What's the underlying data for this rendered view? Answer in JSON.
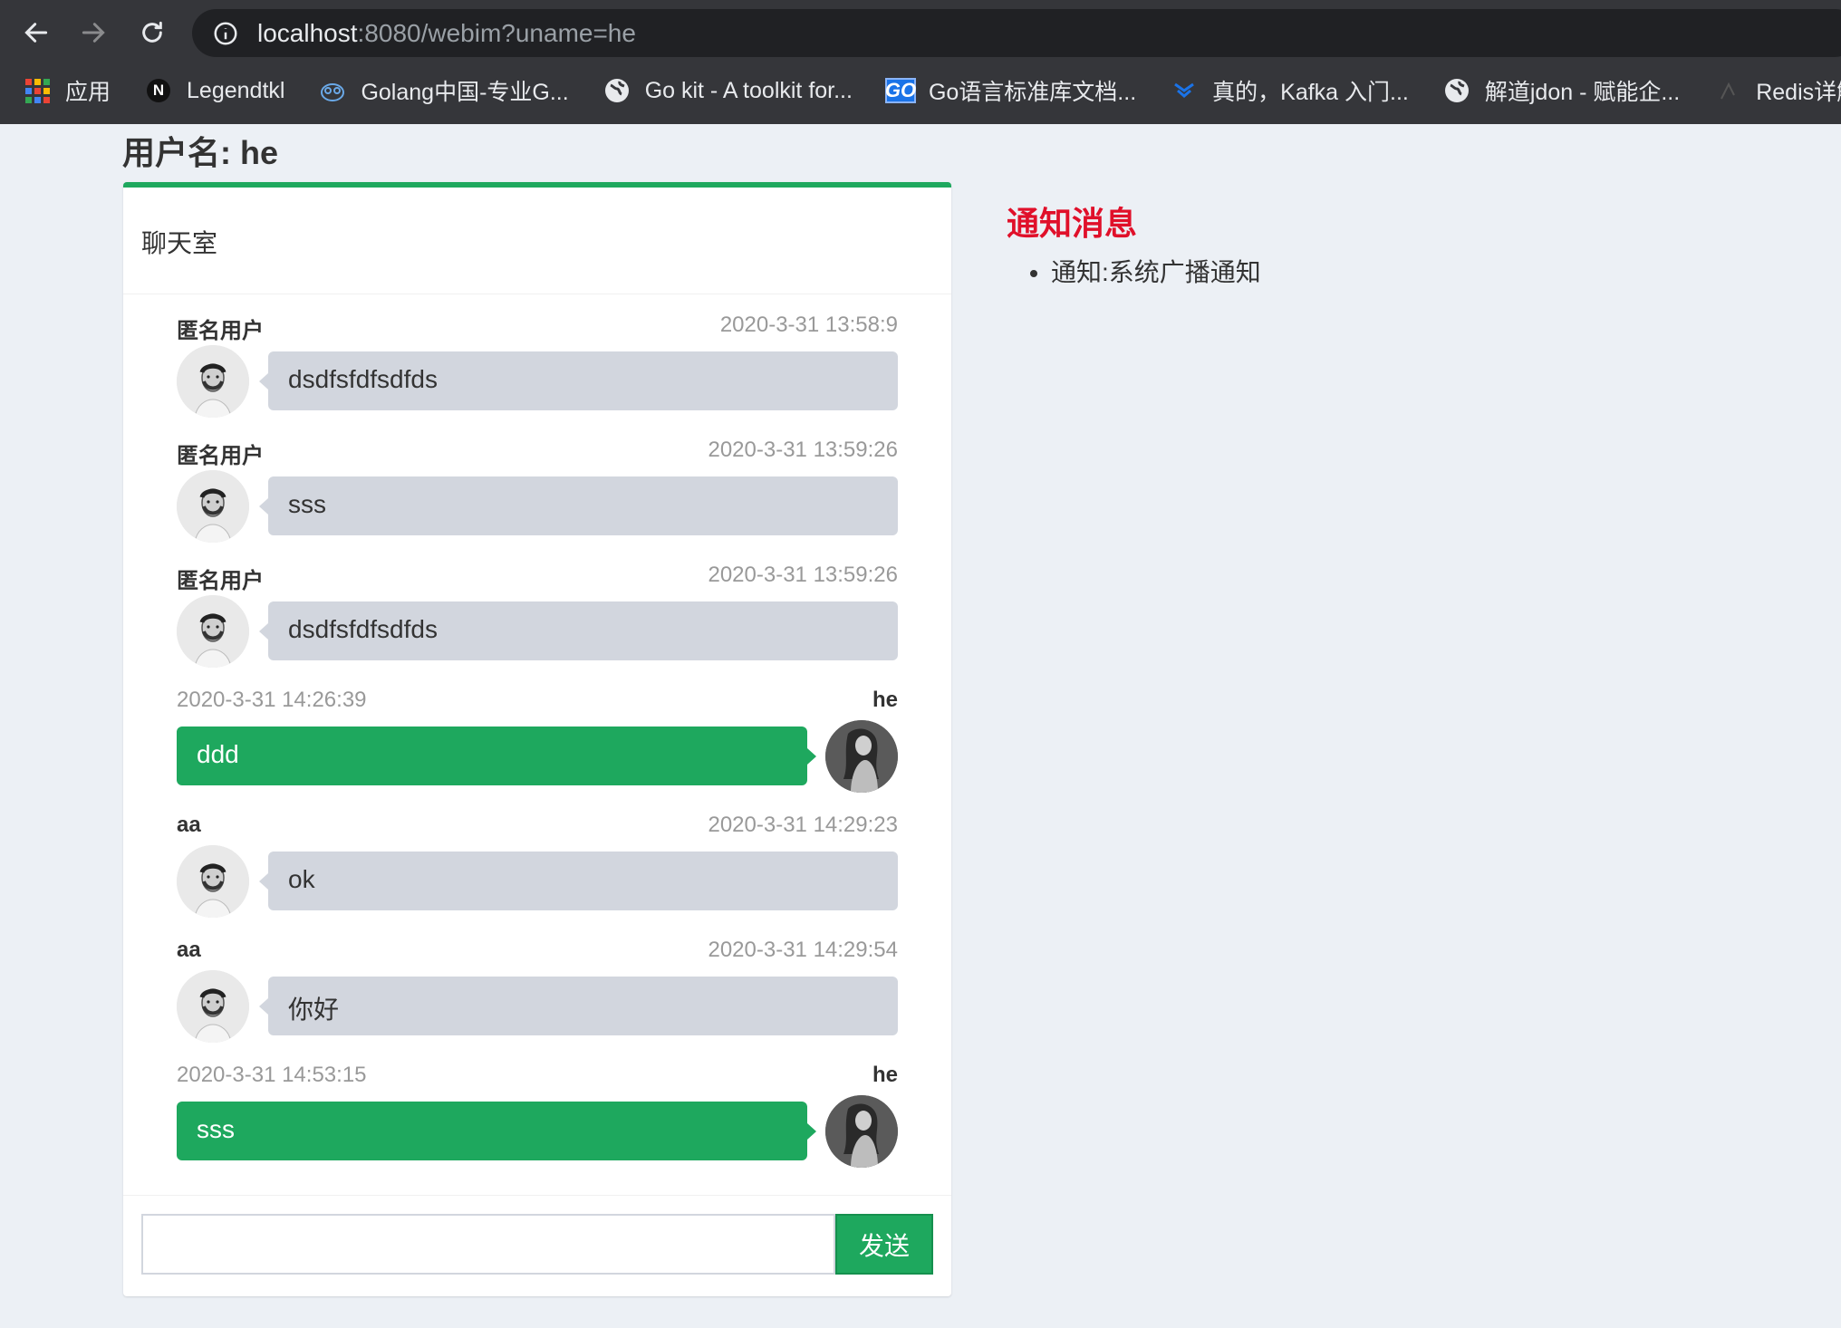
{
  "browser": {
    "url_host": "localhost",
    "url_rest": ":8080/webim?uname=he",
    "bookmarks": [
      {
        "label": "应用",
        "icon": "apps-grid-icon"
      },
      {
        "label": "Legendtkl",
        "icon": "n-logo-icon"
      },
      {
        "label": "Golang中国-专业G...",
        "icon": "gopher-icon"
      },
      {
        "label": "Go kit - A toolkit for...",
        "icon": "globe-icon"
      },
      {
        "label": "Go语言标准库文档...",
        "icon": "go-logo-icon"
      },
      {
        "label": "真的，Kafka 入门...",
        "icon": "chevrons-icon"
      },
      {
        "label": "解道jdon - 赋能企...",
        "icon": "globe-icon"
      },
      {
        "label": "Redis详解",
        "icon": "redis-icon"
      }
    ]
  },
  "page": {
    "username_title": "用户名: he"
  },
  "chat": {
    "title": "聊天室",
    "messages": [
      {
        "side": "left",
        "name": "匿名用户",
        "time": "2020-3-31 13:58:9",
        "text": "dsdfsfdfsdfds"
      },
      {
        "side": "left",
        "name": "匿名用户",
        "time": "2020-3-31 13:59:26",
        "text": "sss"
      },
      {
        "side": "left",
        "name": "匿名用户",
        "time": "2020-3-31 13:59:26",
        "text": "dsdfsfdfsdfds"
      },
      {
        "side": "right",
        "name": "he",
        "time": "2020-3-31 14:26:39",
        "text": "ddd"
      },
      {
        "side": "left",
        "name": "aa",
        "time": "2020-3-31 14:29:23",
        "text": "ok"
      },
      {
        "side": "left",
        "name": "aa",
        "time": "2020-3-31 14:29:54",
        "text": "你好"
      },
      {
        "side": "right",
        "name": "he",
        "time": "2020-3-31 14:53:15",
        "text": "sss"
      }
    ],
    "input_value": "",
    "input_placeholder": "",
    "send_label": "发送"
  },
  "notice": {
    "title": "通知消息",
    "items": [
      "通知:系统广播通知"
    ]
  },
  "colors": {
    "accent_green": "#1ea85e",
    "notice_red": "#e0102a",
    "bubble_gray": "#d2d6de",
    "page_bg": "#ecf0f5"
  }
}
